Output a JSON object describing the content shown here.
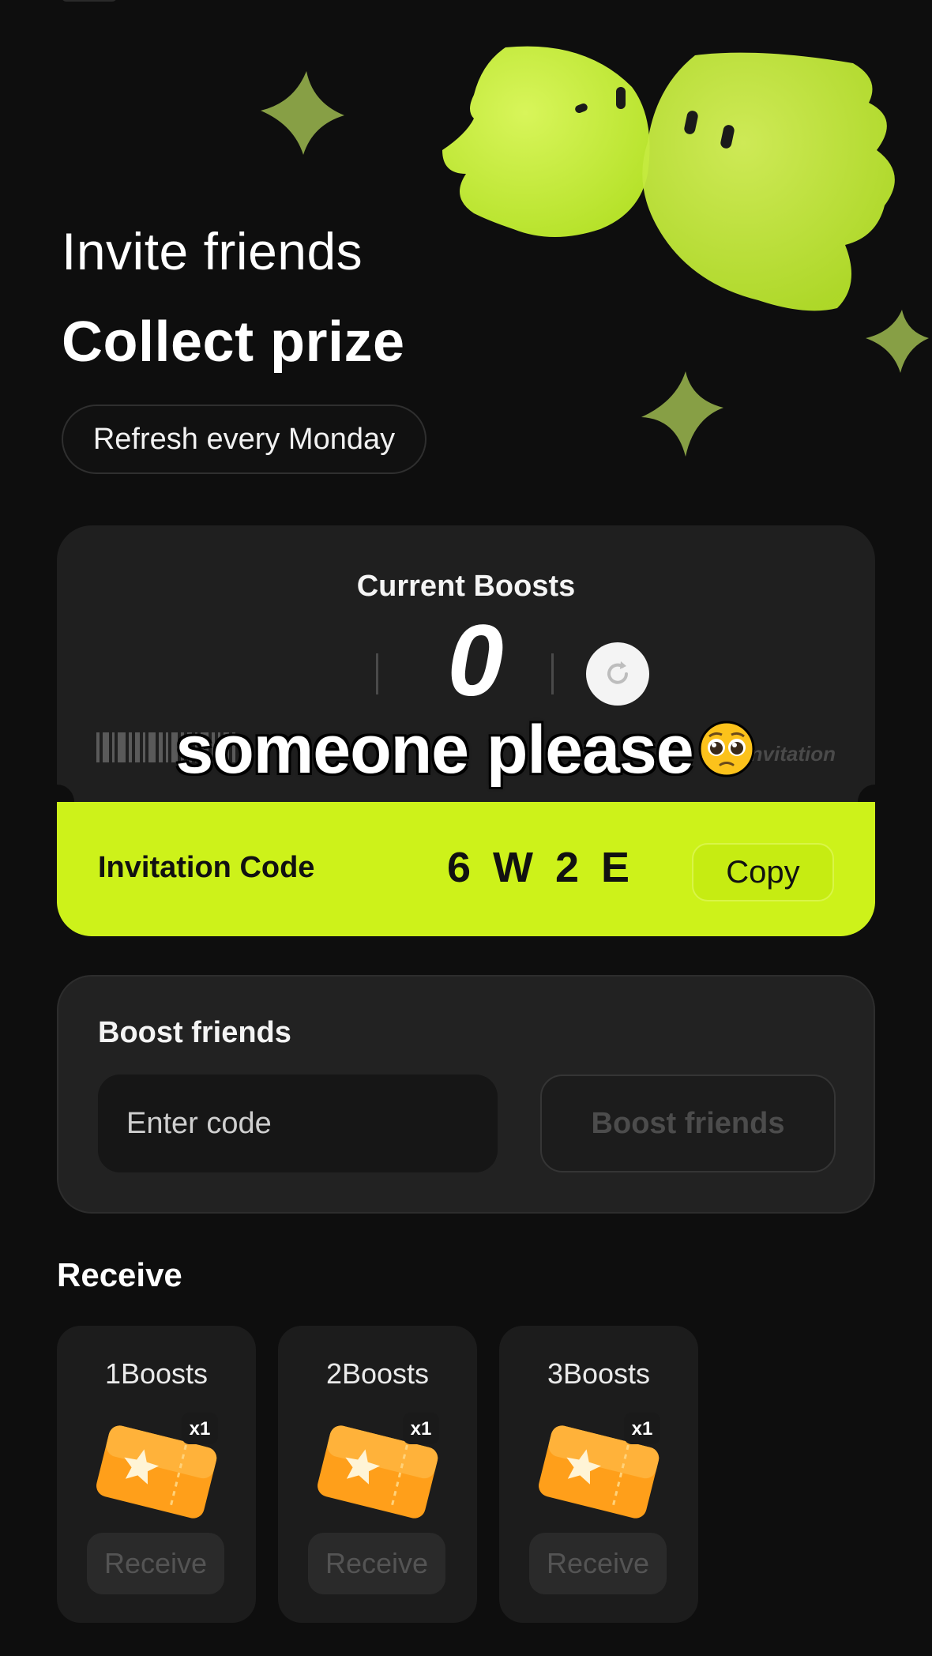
{
  "hero": {
    "title": "Invite friends",
    "subtitle": "Collect prize",
    "refresh_note": "Refresh every Monday"
  },
  "boosts": {
    "label": "Current Boosts",
    "count": "0",
    "invite_word": "invitation"
  },
  "invitation": {
    "label": "Invitation Code",
    "code": "6W2E",
    "copy_label": "Copy"
  },
  "boost_friends": {
    "title": "Boost friends",
    "input_placeholder": "Enter code",
    "button_label": "Boost friends"
  },
  "receive": {
    "title": "Receive",
    "tiers": [
      {
        "label": "1Boosts",
        "reward_qty": "x1",
        "button": "Receive"
      },
      {
        "label": "2Boosts",
        "reward_qty": "x1",
        "button": "Receive"
      },
      {
        "label": "3Boosts",
        "reward_qty": "x1",
        "button": "Receive"
      }
    ]
  },
  "overlay_caption": "someone please",
  "colors": {
    "accent": "#cdf21a",
    "background": "#0e0e0e",
    "card": "#1f1f1f",
    "ticket": "#ff9f1a"
  },
  "icons": [
    "ghost-mascot-icon",
    "sparkle-star-icon",
    "refresh-icon",
    "barcode-icon",
    "ticket-icon",
    "pleading-face-emoji-icon"
  ]
}
